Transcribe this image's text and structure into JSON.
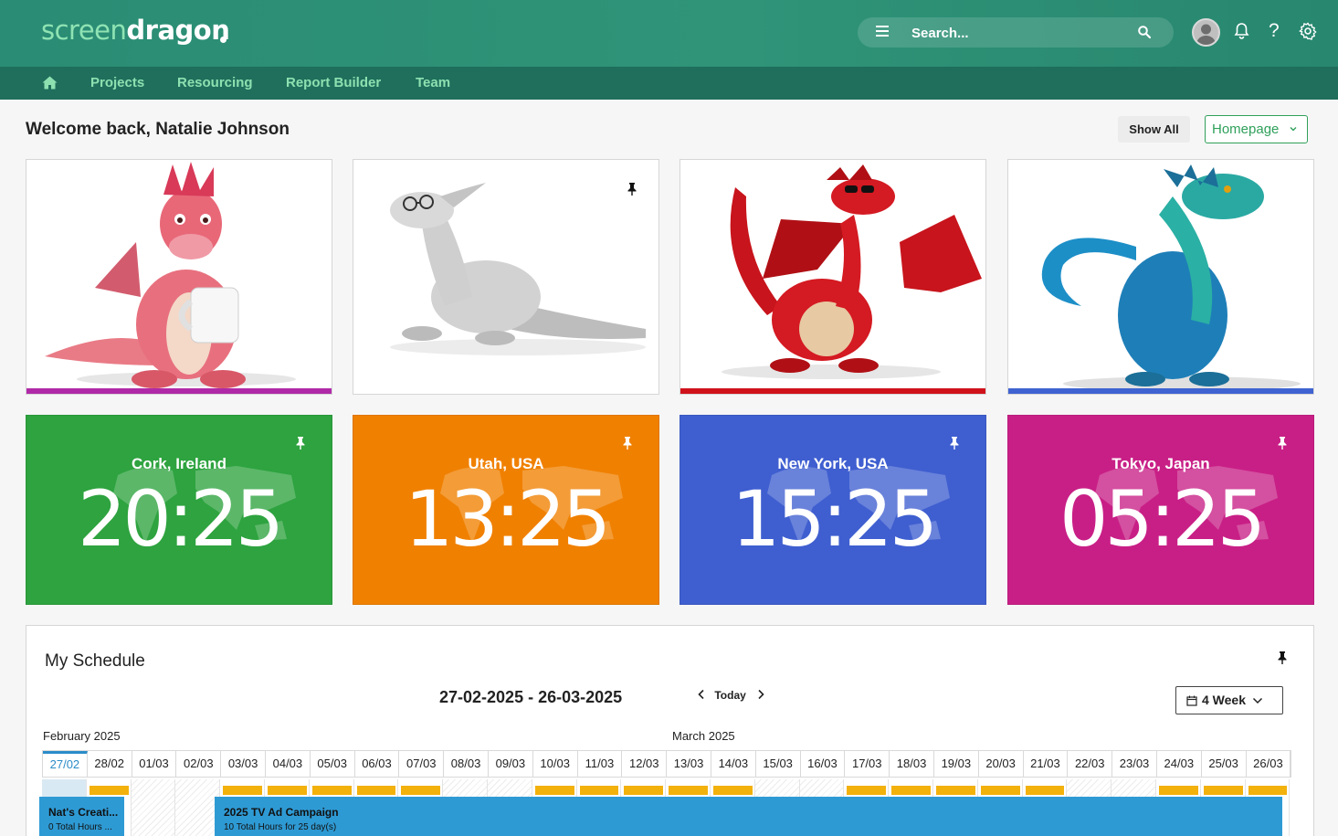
{
  "brand": {
    "part1": "screen",
    "part2": "dragon"
  },
  "header": {
    "search_placeholder": "Search...",
    "icons": [
      "menu-icon",
      "search-icon",
      "avatar",
      "bell-icon",
      "help-icon",
      "gear-icon"
    ]
  },
  "nav": {
    "items": [
      "Projects",
      "Resourcing",
      "Report Builder",
      "Team"
    ]
  },
  "welcome": "Welcome back, Natalie Johnson",
  "controls": {
    "show_all": "Show All",
    "homepage": "Homepage"
  },
  "dragon_cards": [
    {
      "dragon": "pink dragon holding mug",
      "accent": "#b02aa8"
    },
    {
      "dragon": "white dragon with glasses",
      "accent": "",
      "pinned": true
    },
    {
      "dragon": "red dragon with sunglasses",
      "accent": "#d0121b"
    },
    {
      "dragon": "blue-green dragon",
      "accent": "#3f63d1"
    }
  ],
  "clocks": [
    {
      "city": "Cork, Ireland",
      "time": "20:25",
      "color": "#2ea33f"
    },
    {
      "city": "Utah, USA",
      "time": "13:25",
      "color": "#f08000"
    },
    {
      "city": "New York, USA",
      "time": "15:25",
      "color": "#3f5fd0"
    },
    {
      "city": "Tokyo, Japan",
      "time": "05:25",
      "color": "#c81f86"
    }
  ],
  "schedule": {
    "title": "My Schedule",
    "range": "27-02-2025 - 26-03-2025",
    "today": "Today",
    "view": "4 Week",
    "months": [
      "February 2025",
      "March 2025"
    ],
    "dates": [
      "27/02",
      "28/02",
      "01/03",
      "02/03",
      "03/03",
      "04/03",
      "05/03",
      "06/03",
      "07/03",
      "08/03",
      "09/03",
      "10/03",
      "11/03",
      "12/03",
      "13/03",
      "14/03",
      "15/03",
      "16/03",
      "17/03",
      "18/03",
      "19/03",
      "20/03",
      "21/03",
      "22/03",
      "23/03",
      "24/03",
      "25/03",
      "26/03"
    ],
    "tasks": [
      {
        "name": "Nat's Creati...",
        "hours": "0 Total Hours ..."
      },
      {
        "name": "2025 TV Ad Campaign",
        "hours": "10 Total Hours for 25 day(s)"
      }
    ]
  }
}
